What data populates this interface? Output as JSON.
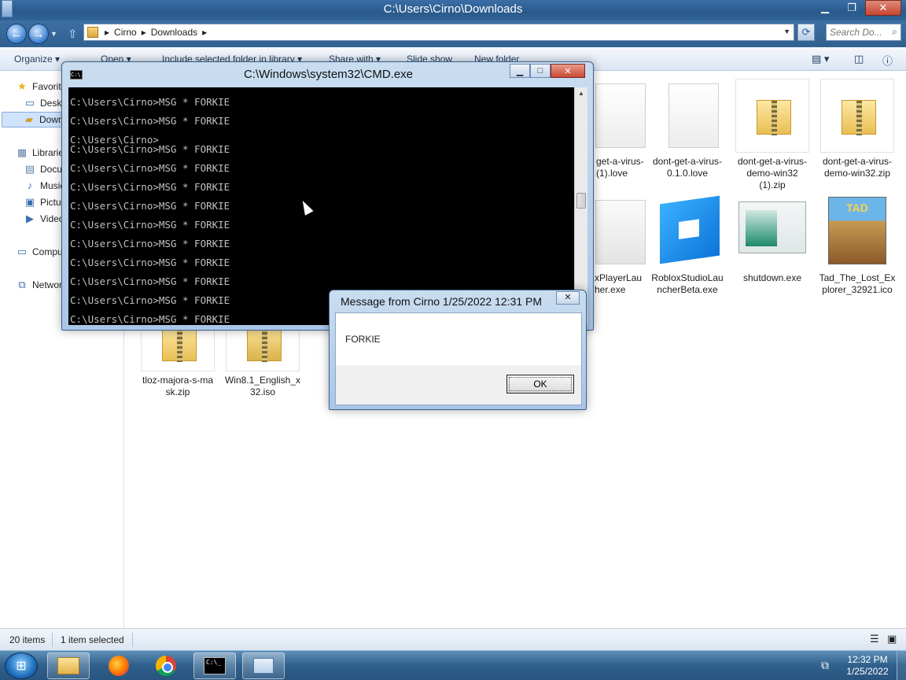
{
  "explorer": {
    "title": "C:\\Users\\Cirno\\Downloads",
    "breadcrumbs": [
      "Cirno",
      "Downloads"
    ],
    "search_placeholder": "Search Do...",
    "toolbar": {
      "organize": "Organize ▾",
      "open": "Open ▾",
      "include": "Include selected folder in library ▾",
      "share": "Share with ▾",
      "slideshow": "Slide show",
      "newfolder": "New folder"
    },
    "nav": {
      "favorites": "Favorites",
      "desktop": "Desktop",
      "downloads": "Downloads",
      "libraries": "Libraries",
      "documents": "Documents",
      "music": "Music",
      "pictures": "Pictures",
      "videos": "Videos",
      "computer": "Computer",
      "network": "Network"
    },
    "files": {
      "f1": "get-a-virus-\n(1).love",
      "f2": "dont-get-a-virus-\n0.1.0.love",
      "f3": "dont-get-a-virus-\ndemo-win32\n(1).zip",
      "f4": "dont-get-a-virus-\ndemo-win32.zip",
      "f5": "xPlayerLau\nher.exe",
      "f6": "RobloxStudioLau\nncherBeta.exe",
      "f7": "shutdown.exe",
      "f8": "Tad_The_Lost_Ex\nplorer_32921.ico",
      "f9": "tloz-majora-s-ma\nsk.zip",
      "f10": "Win8.1_English_x\n32.iso"
    },
    "status": {
      "count": "20 items",
      "selected": "1 item selected"
    }
  },
  "cmd": {
    "title": "C:\\Windows\\system32\\CMD.exe",
    "lines": [
      "C:\\Users\\Cirno>MSG * FORKIE",
      "C:\\Users\\Cirno>MSG * FORKIE",
      "C:\\Users\\Cirno>",
      "C:\\Users\\Cirno>MSG * FORKIE",
      "C:\\Users\\Cirno>MSG * FORKIE",
      "C:\\Users\\Cirno>MSG * FORKIE",
      "C:\\Users\\Cirno>MSG * FORKIE",
      "C:\\Users\\Cirno>MSG * FORKIE",
      "C:\\Users\\Cirno>MSG * FORKIE",
      "C:\\Users\\Cirno>MSG * FORKIE",
      "C:\\Users\\Cirno>MSG * FORKIE",
      "C:\\Users\\Cirno>MSG * FORKIE",
      "C:\\Users\\Cirno>MSG * FORKIE"
    ]
  },
  "message": {
    "title": "Message from Cirno 1/25/2022 12:31 PM",
    "text": "FORKIE",
    "ok": "OK"
  },
  "taskbar": {
    "time": "12:32 PM",
    "date": "1/25/2022"
  },
  "poster_text": "TAD"
}
